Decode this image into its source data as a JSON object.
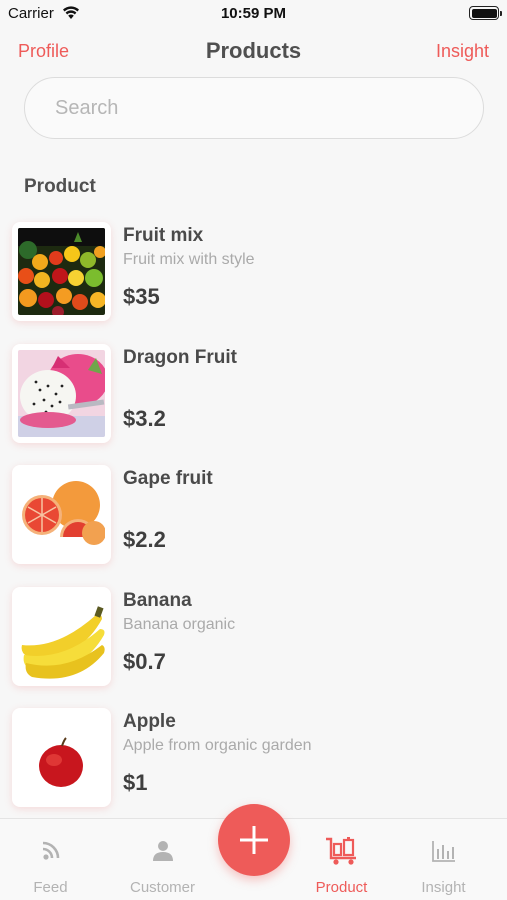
{
  "status_bar": {
    "carrier": "Carrier",
    "time": "10:59 PM"
  },
  "nav": {
    "left": "Profile",
    "title": "Products",
    "right": "Insight"
  },
  "search": {
    "placeholder": "Search",
    "value": ""
  },
  "section_title": "Product",
  "products": [
    {
      "name": "Fruit mix",
      "description": "Fruit mix with style",
      "price": "$35",
      "image": "fruit-mix-image"
    },
    {
      "name": "Dragon Fruit",
      "description": "",
      "price": "$3.2",
      "image": "dragon-fruit-image"
    },
    {
      "name": "Gape fruit",
      "description": "",
      "price": "$2.2",
      "image": "grapefruit-image"
    },
    {
      "name": "Banana",
      "description": "Banana organic",
      "price": "$0.7",
      "image": "banana-image"
    },
    {
      "name": "Apple",
      "description": "Apple from organic garden",
      "price": "$1",
      "image": "apple-image"
    }
  ],
  "tabs": [
    {
      "label": "Feed",
      "icon": "rss-icon",
      "active": false
    },
    {
      "label": "Customer",
      "icon": "person-icon",
      "active": false
    },
    {
      "label": "Product",
      "icon": "cart-icon",
      "active": true
    },
    {
      "label": "Insight",
      "icon": "bar-chart-icon",
      "active": false
    }
  ],
  "fab": {
    "icon": "plus-icon"
  },
  "colors": {
    "accent": "#ee5b59",
    "inactive": "#b3b3b3",
    "background": "#f7f7f7"
  }
}
